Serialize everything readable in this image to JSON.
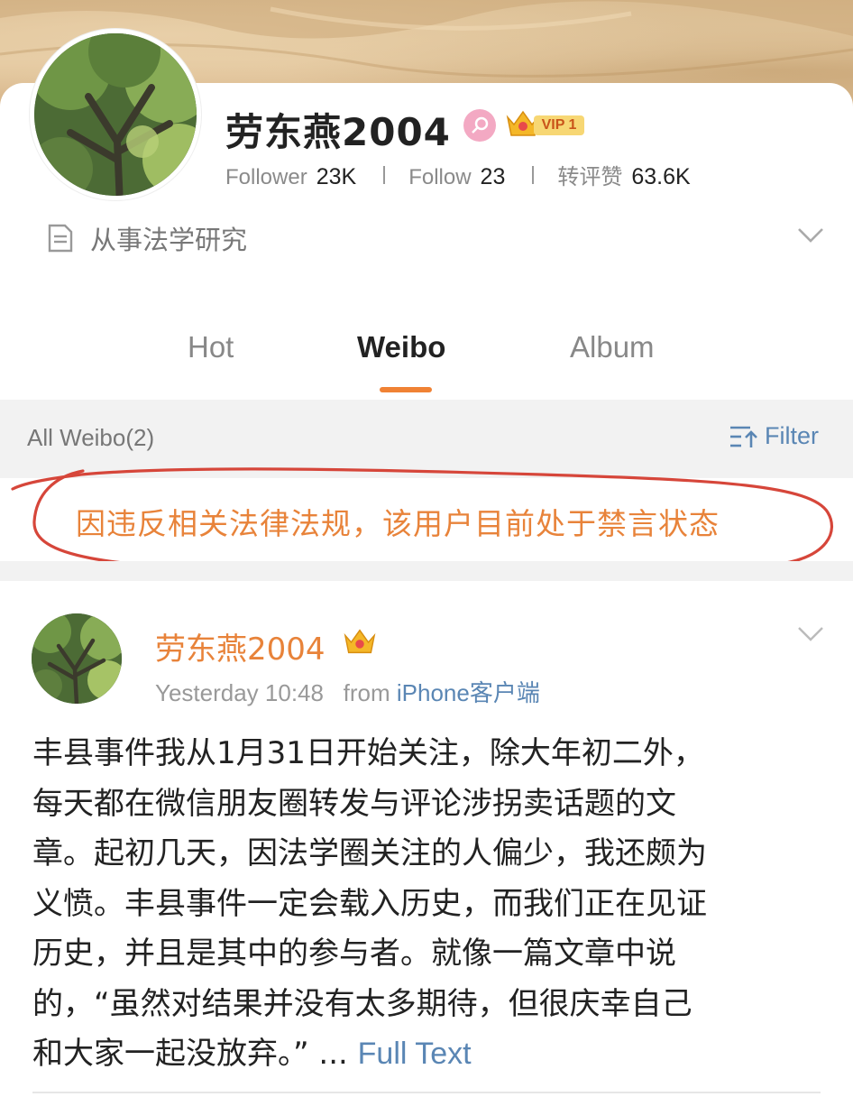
{
  "profile": {
    "name": "劳东燕2004",
    "vip_label": "VIP 1",
    "stats": [
      {
        "label": "Follower",
        "value": "23K"
      },
      {
        "label": "Follow",
        "value": "23"
      },
      {
        "label": "转评赞",
        "value": "63.6K"
      }
    ],
    "bio": "从事法学研究"
  },
  "tabs": [
    {
      "label": "Hot"
    },
    {
      "label": "Weibo"
    },
    {
      "label": "Album"
    }
  ],
  "filter_bar": {
    "all_label": "All Weibo(2)",
    "filter_label": "Filter"
  },
  "notice": "因违反相关法律法规，该用户目前处于禁言状态",
  "post": {
    "author": "劳东燕2004",
    "time": "Yesterday 10:48",
    "from_label": "from",
    "source": "iPhone客户端",
    "lines": [
      "丰县事件我从1月31日开始关注，除大年初二外，",
      "每天都在微信朋友圈转发与评论涉拐卖话题的文",
      "章。起初几天，因法学圈关注的人偏少，我还颇为",
      "义愤。丰县事件一定会载入历史，而我们正在见证",
      "历史，并且是其中的参与者。就像一篇文章中说",
      "的，“虽然对结果并没有太多期待，但很庆幸自己",
      "和大家一起没放弃。” ... "
    ],
    "full_text": "Full Text"
  },
  "colors": {
    "accent_orange": "#f08234",
    "link_blue": "#5a86b4",
    "annotation_red": "#d6463a"
  }
}
